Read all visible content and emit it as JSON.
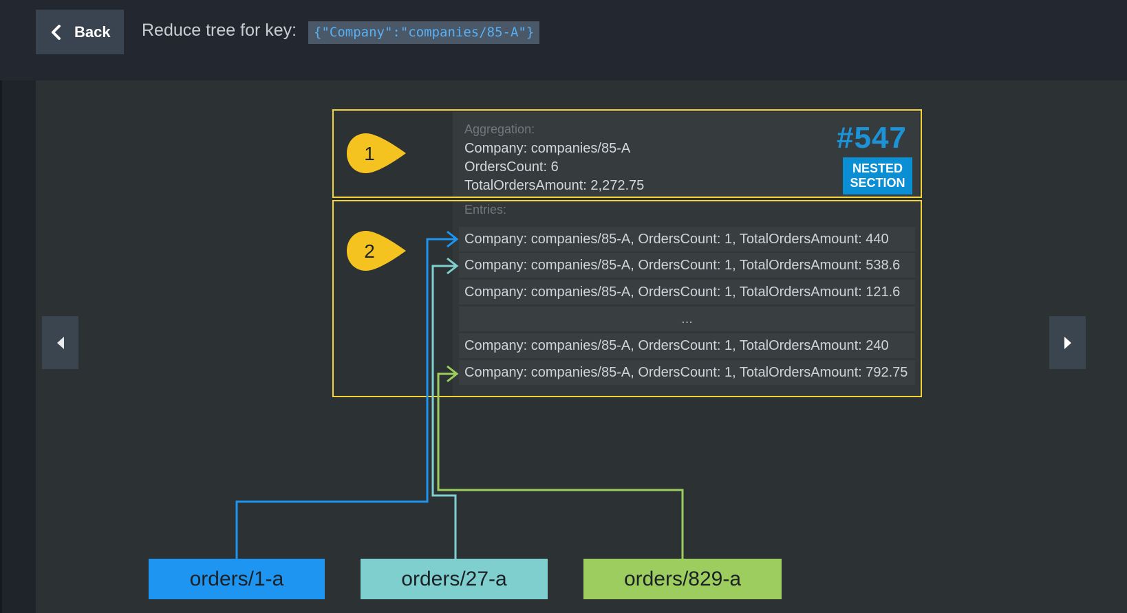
{
  "header": {
    "back_label": "Back",
    "title_label": "Reduce tree for key:",
    "key_value": "{\"Company\":\"companies/85-A\"}"
  },
  "aggregation": {
    "label": "Aggregation:",
    "lines": [
      "Company: companies/85-A",
      "OrdersCount: 6",
      "TotalOrdersAmount: 2,272.75"
    ],
    "page_number": "#547",
    "badge_line1": "NESTED",
    "badge_line2": "SECTION"
  },
  "entries": {
    "label": "Entries:",
    "rows": [
      "Company: companies/85-A, OrdersCount: 1, TotalOrdersAmount: 440",
      "Company: companies/85-A, OrdersCount: 1, TotalOrdersAmount: 538.6",
      "Company: companies/85-A, OrdersCount: 1, TotalOrdersAmount: 121.6",
      "...",
      "Company: companies/85-A, OrdersCount: 1, TotalOrdersAmount: 240",
      "Company: companies/85-A, OrdersCount: 1, TotalOrdersAmount: 792.75"
    ]
  },
  "callouts": [
    "1",
    "2"
  ],
  "documents": [
    "orders/1-a",
    "orders/27-a",
    "orders/829-a"
  ],
  "colors": {
    "highlight": "#f5d33a",
    "accent": "#1b93d6",
    "doc1": "#1e95f0",
    "doc2": "#7fcfcf",
    "doc3": "#9dcd5e"
  },
  "icons": {
    "back": "chevron-left-icon",
    "prev": "caret-left-icon",
    "next": "caret-right-icon"
  }
}
